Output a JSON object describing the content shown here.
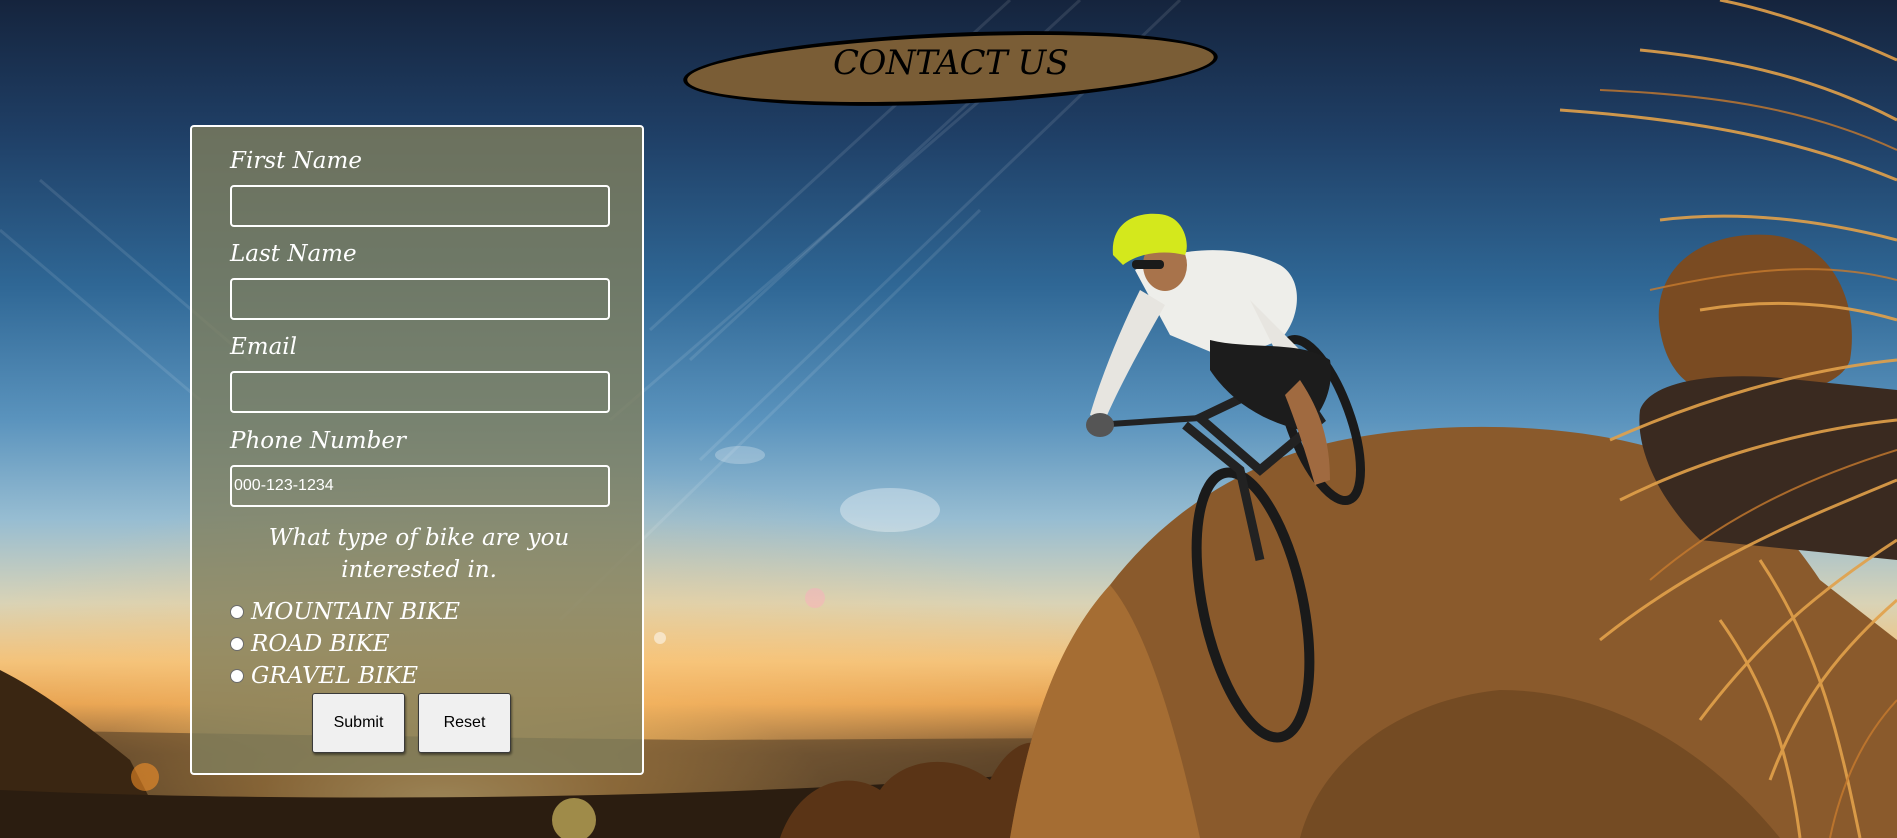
{
  "header": {
    "title": "CONTACT US"
  },
  "form": {
    "fields": [
      {
        "label": "First Name",
        "value": "",
        "placeholder": ""
      },
      {
        "label": "Last Name",
        "value": "",
        "placeholder": ""
      },
      {
        "label": "Email",
        "value": "",
        "placeholder": ""
      },
      {
        "label": "Phone Number",
        "value": "",
        "placeholder": "000-123-1234"
      }
    ],
    "question": "What type of bike are you interested in.",
    "options": [
      {
        "label": "MOUNTAIN BIKE",
        "selected": false
      },
      {
        "label": "ROAD BIKE",
        "selected": false
      },
      {
        "label": "GRAVEL BIKE",
        "selected": false
      }
    ],
    "submit_label": "Submit",
    "reset_label": "Reset"
  },
  "colors": {
    "title_oval": "#7a5d36",
    "panel": "#807e5c",
    "helmet": "#d4e81c"
  }
}
